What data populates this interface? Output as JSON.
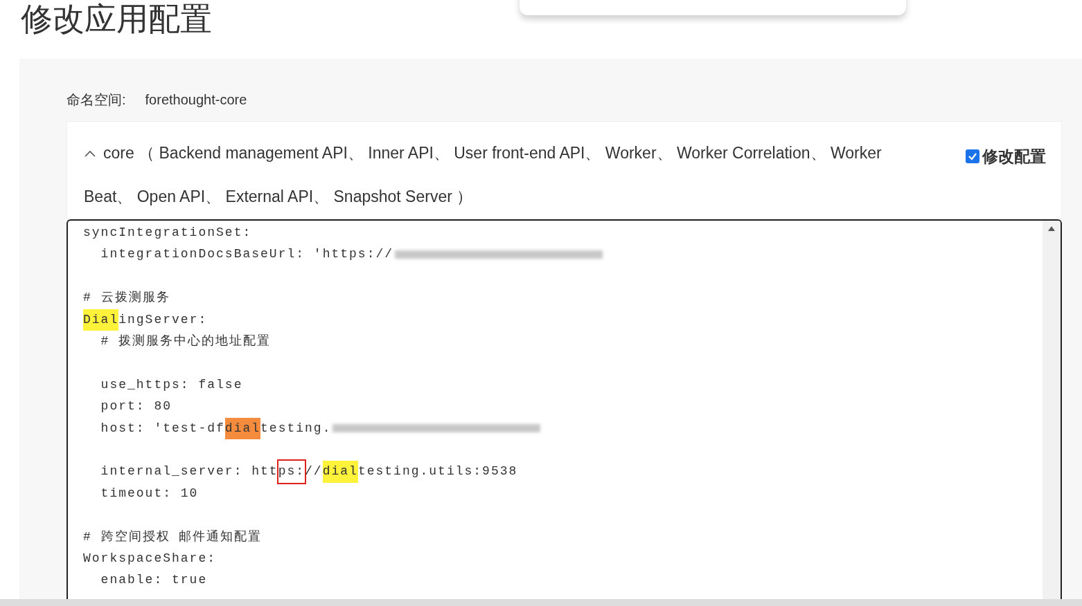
{
  "page_title": "修改应用配置",
  "namespace": {
    "label": "命名空间:",
    "value": "forethought-core"
  },
  "app": {
    "expanded": true,
    "header_lines": [
      "core （ Backend management API、 Inner API、 User front-end API、 Worker、 Worker Correlation、 Worker",
      "Beat、 Open API、 External API、 Snapshot Server ）"
    ],
    "modify": {
      "label": "修改配置",
      "checked": true
    }
  },
  "editor": {
    "lines": [
      {
        "kind": "code",
        "segments": [
          {
            "text": "syncIntegrationSet:",
            "kind": "plain"
          }
        ]
      },
      {
        "kind": "code",
        "segments": [
          {
            "text": "  integrationDocsBaseUrl: 'https://",
            "kind": "plain"
          }
        ],
        "redacted": true
      },
      {
        "kind": "blank"
      },
      {
        "kind": "code",
        "segments": [
          {
            "text": "# 云拨测服务",
            "kind": "plain"
          }
        ]
      },
      {
        "kind": "code",
        "segments": [
          {
            "text": "Dial",
            "kind": "mark",
            "color": "#fff23a"
          },
          {
            "text": "ingServer:",
            "kind": "plain"
          }
        ]
      },
      {
        "kind": "code",
        "segments": [
          {
            "text": "  # 拨测服务中心的地址配置",
            "kind": "plain"
          }
        ]
      },
      {
        "kind": "blank"
      },
      {
        "kind": "code",
        "segments": [
          {
            "text": "  use_https: false",
            "kind": "plain"
          }
        ]
      },
      {
        "kind": "code",
        "segments": [
          {
            "text": "  port: 80",
            "kind": "plain"
          }
        ]
      },
      {
        "kind": "code",
        "segments": [
          {
            "text": "  host: 'test-df",
            "kind": "plain"
          },
          {
            "text": "dial",
            "kind": "mark",
            "color": "#f58b3c"
          },
          {
            "text": "testing.",
            "kind": "plain"
          }
        ],
        "redacted": true
      },
      {
        "kind": "blank"
      },
      {
        "kind": "code",
        "segments": [
          {
            "text": "  internal_server: htt",
            "kind": "plain"
          },
          {
            "text": "ps:",
            "kind": "boxed"
          },
          {
            "text": "//",
            "kind": "plain"
          },
          {
            "text": "dial",
            "kind": "mark",
            "color": "#fff23a"
          },
          {
            "text": "testing.utils:9538",
            "kind": "plain"
          }
        ]
      },
      {
        "kind": "code",
        "segments": [
          {
            "text": "  timeout: 10",
            "kind": "plain"
          }
        ]
      },
      {
        "kind": "blank"
      },
      {
        "kind": "code",
        "segments": [
          {
            "text": "# 跨空间授权 邮件通知配置",
            "kind": "plain"
          }
        ]
      },
      {
        "kind": "code",
        "segments": [
          {
            "text": "WorkspaceShare:",
            "kind": "plain"
          }
        ]
      },
      {
        "kind": "code",
        "segments": [
          {
            "text": "  enable: true",
            "kind": "plain"
          }
        ]
      }
    ]
  }
}
